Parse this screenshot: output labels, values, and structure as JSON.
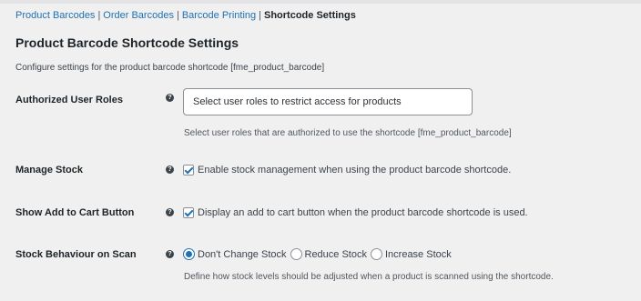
{
  "subnav": {
    "items": [
      {
        "label": "Product Barcodes"
      },
      {
        "label": "Order Barcodes"
      },
      {
        "label": "Barcode Printing"
      },
      {
        "label": "Shortcode Settings"
      }
    ],
    "separator": "|"
  },
  "page": {
    "title": "Product Barcode Shortcode Settings",
    "description": "Configure settings for the product barcode shortcode [fme_product_barcode]"
  },
  "settings": {
    "authorized_roles": {
      "label": "Authorized User Roles",
      "placeholder": "Select user roles to restrict access for products",
      "description": "Select user roles that are authorized to use the shortcode [fme_product_barcode]"
    },
    "manage_stock": {
      "label": "Manage Stock",
      "checkbox_label": "Enable stock management when using the product barcode shortcode.",
      "checked": true
    },
    "show_cart": {
      "label": "Show Add to Cart Button",
      "checkbox_label": "Display an add to cart button when the product barcode shortcode is used.",
      "checked": true
    },
    "stock_behaviour": {
      "label": "Stock Behaviour on Scan",
      "options": [
        "Don't Change Stock",
        "Reduce Stock",
        "Increase Stock"
      ],
      "selected": "Don't Change Stock",
      "description": "Define how stock levels should be adjusted when a product is scanned using the shortcode."
    }
  },
  "icons": {
    "help": "question-circle-icon",
    "help_glyph": "?"
  },
  "colors": {
    "link": "#2271b1",
    "background": "#f0f0f1",
    "text": "#1d2327",
    "accent": "#2271b1"
  }
}
